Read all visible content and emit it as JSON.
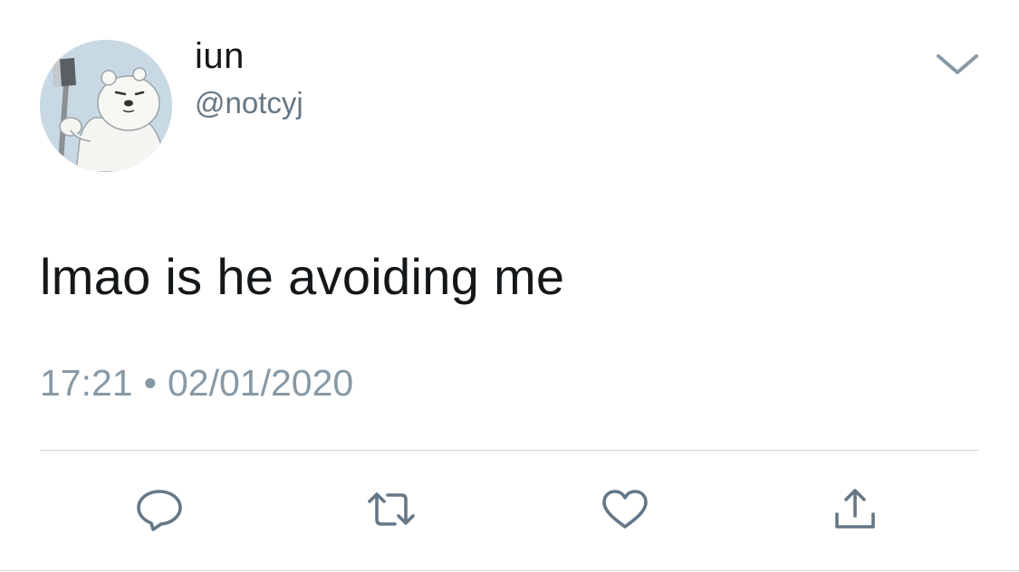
{
  "user": {
    "display_name": "iun",
    "handle": "@notcyj",
    "avatar_icon": "polar-bear-with-axe-avatar"
  },
  "tweet": {
    "text": "lmao is he avoiding me",
    "time": "17:21",
    "separator": "•",
    "date": "02/01/2020"
  },
  "actions": {
    "reply_icon": "reply-icon",
    "retweet_icon": "retweet-icon",
    "like_icon": "like-icon",
    "share_icon": "share-icon"
  },
  "colors": {
    "text": "#14171a",
    "secondary": "#657786",
    "meta": "#8899a6",
    "icon": "#657786",
    "divider": "#cfd6dc",
    "background": "#ffffff"
  }
}
